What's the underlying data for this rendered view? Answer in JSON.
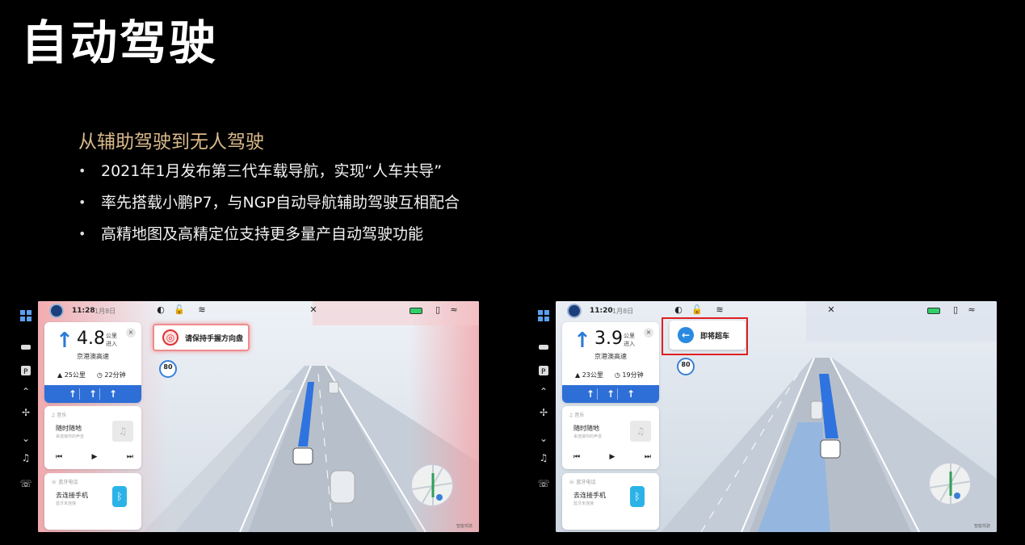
{
  "slide": {
    "title": "自动驾驶",
    "subtitle": "从辅助驾驶到无人驾驶",
    "bullets": [
      "2021年1月发布第三代车载导航，实现“人车共导”",
      "率先搭载小鹏P7，与NGP自动导航辅助驾驶互相配合",
      "高精地图及高精定位支持更多量产自动驾驶功能"
    ],
    "bullet_symbol": "•"
  },
  "colors": {
    "background": "#000000",
    "subtitle": "#d9b98a",
    "nav_blue": "#2d6fd6",
    "warning_red": "#e02020"
  },
  "side_strip_icons": [
    "apps-grid-icon",
    "car-icon",
    "parking-icon",
    "chevron-up-icon",
    "fan-icon",
    "chevron-down-icon",
    "music-icon",
    "phone-icon"
  ],
  "screens": [
    {
      "time": "11:28",
      "date": "1月8日",
      "distance": "4.8",
      "unit": "公里",
      "unit_action": "进入",
      "road": "京港澳高速",
      "remaining_km": "25公里",
      "remaining_time": "22分钟",
      "lanes": [
        "↑",
        "↑",
        "↑"
      ],
      "alert_text": "请保持手握方向盘",
      "speed_limit": "80",
      "music_header": "音乐",
      "song": "随时随地",
      "artist": "来连接你的声音",
      "phone_header": "蓝牙电话",
      "phone_text": "去连接手机",
      "phone_sub": "蓝牙未连接",
      "close": "×",
      "media_controls": [
        "⏮",
        "▶",
        "⏭"
      ],
      "watermark": "智能驾驶"
    },
    {
      "time": "11:20",
      "date": "1月8日",
      "distance": "3.9",
      "unit": "公里",
      "unit_action": "进入",
      "road": "京港澳高速",
      "remaining_km": "23公里",
      "remaining_time": "19分钟",
      "lanes": [
        "↑",
        "↑",
        "↑"
      ],
      "alert_text": "即将超车",
      "speed_limit": "80",
      "music_header": "音乐",
      "song": "随时随地",
      "artist": "来连接你的声音",
      "phone_header": "蓝牙电话",
      "phone_text": "去连接手机",
      "phone_sub": "蓝牙未连接",
      "close": "×",
      "media_controls": [
        "⏮",
        "▶",
        "⏭"
      ],
      "watermark": "智能驾驶"
    }
  ]
}
